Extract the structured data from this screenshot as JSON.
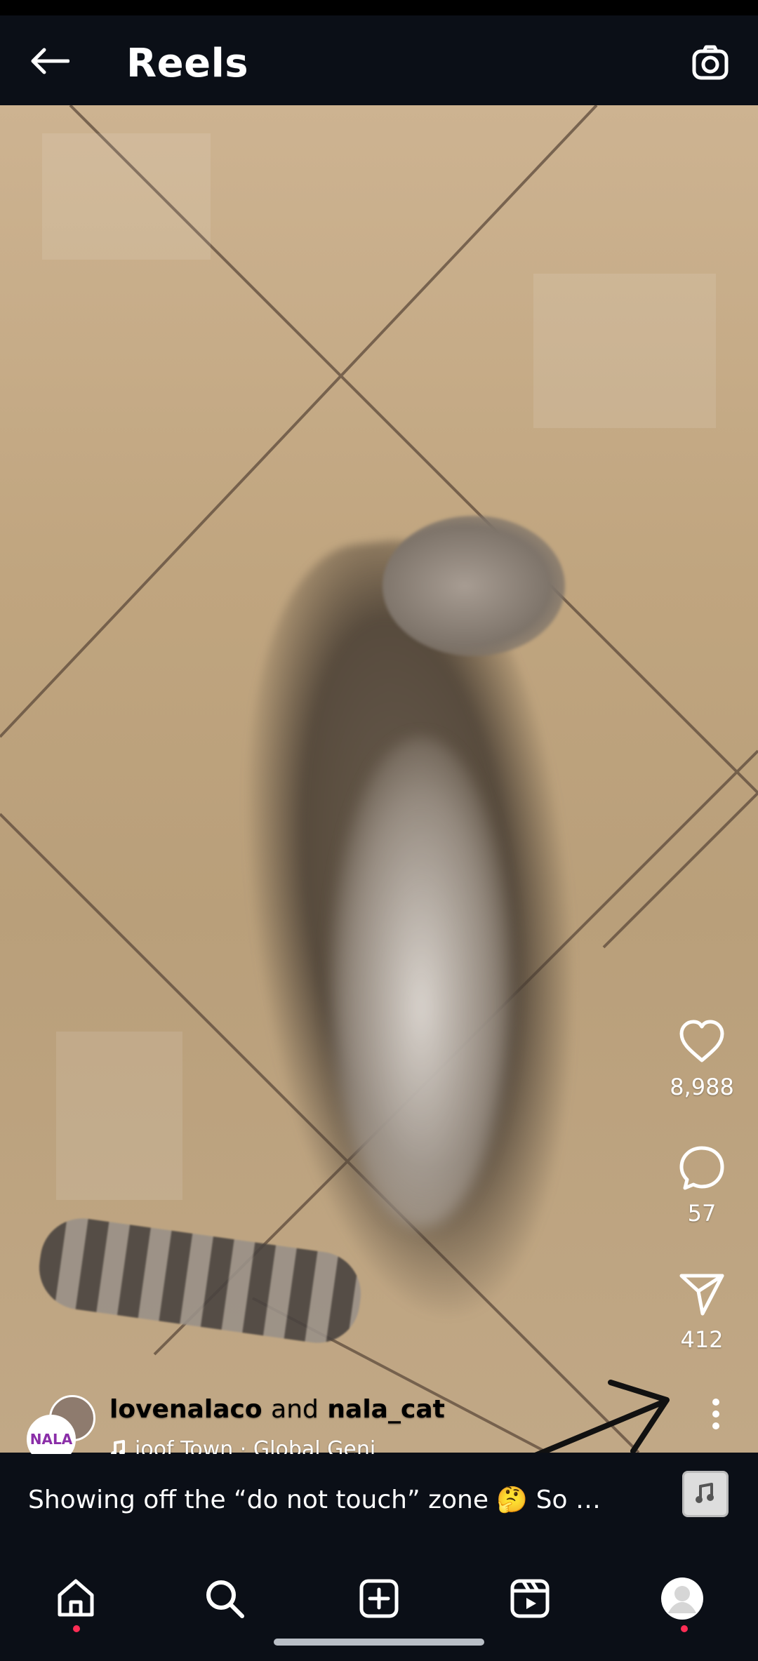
{
  "header": {
    "title": "Reels"
  },
  "reel": {
    "likes": "8,988",
    "comments": "57",
    "shares": "412",
    "user_a": "lovenalaco",
    "conjunction": "and",
    "user_b": "nala_cat",
    "audio_fragment": "ioof Town · Global Geni",
    "caption": "Showing off the “do not touch” zone 🤔 So …",
    "avatar_text": "NALA"
  },
  "nav": {
    "items": [
      "home-icon",
      "search-icon",
      "add-post-icon",
      "reels-icon",
      "profile-avatar"
    ]
  },
  "colors": {
    "accent": "#ff2d55",
    "background": "#0b0f17"
  }
}
